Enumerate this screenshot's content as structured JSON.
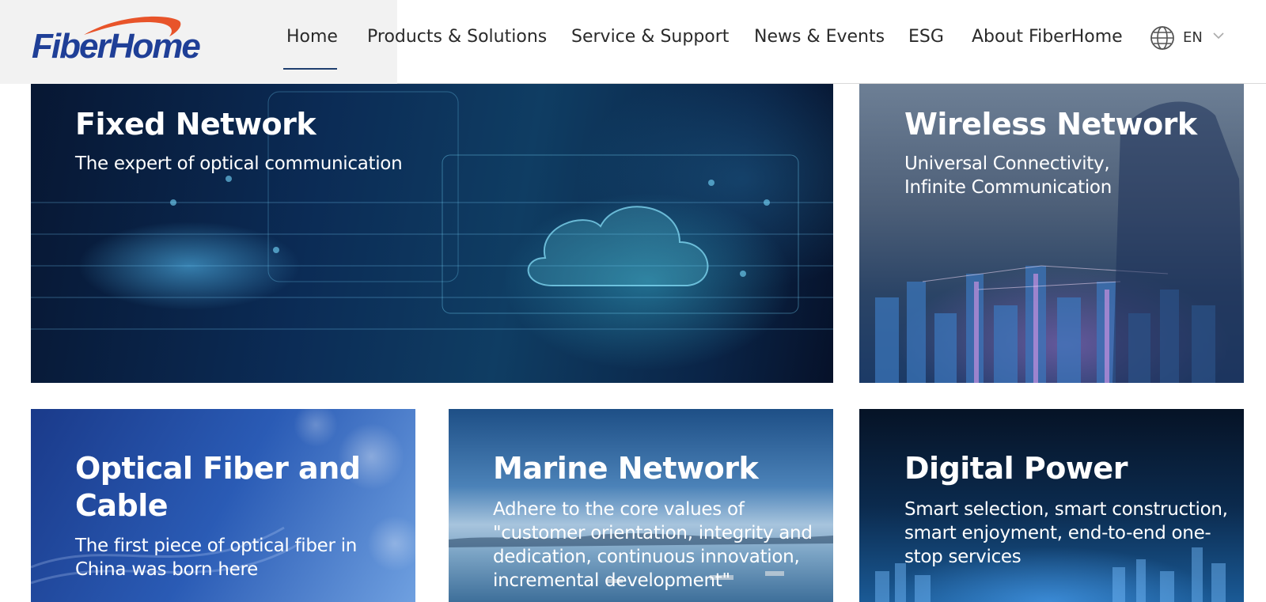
{
  "header": {
    "logo_text": "FiberHome",
    "nav": [
      {
        "label": "Home",
        "active": true
      },
      {
        "label": "Products & Solutions",
        "active": false
      },
      {
        "label": "Service & Support",
        "active": false
      },
      {
        "label": "News & Events",
        "active": false
      },
      {
        "label": "ESG",
        "active": false
      },
      {
        "label": "About FiberHome",
        "active": false
      }
    ],
    "language": "EN",
    "language_icon": "globe-icon"
  },
  "cards": [
    {
      "title": "Fixed Network",
      "subtitle": "The expert of optical communication"
    },
    {
      "title": "Wireless Network",
      "subtitle_lines": [
        "Universal Connectivity,",
        "Infinite Communication"
      ]
    },
    {
      "title_lines": [
        "Optical Fiber and",
        "Cable"
      ],
      "subtitle_lines": [
        "The first piece of optical fiber in",
        "China was born here"
      ]
    },
    {
      "title": "Marine Network",
      "subtitle_lines": [
        "Adhere to the core values of",
        "\"customer orientation, integrity and",
        "dedication, continuous innovation,",
        "incremental development\""
      ]
    },
    {
      "title": "Digital Power",
      "subtitle_lines": [
        "Smart selection, smart construction,",
        "smart enjoyment, end-to-end one-",
        "stop services"
      ]
    }
  ],
  "colors": {
    "brand_blue": "#1f3f97",
    "brand_orange": "#e8542a",
    "nav_underline": "#1f3f6f"
  }
}
